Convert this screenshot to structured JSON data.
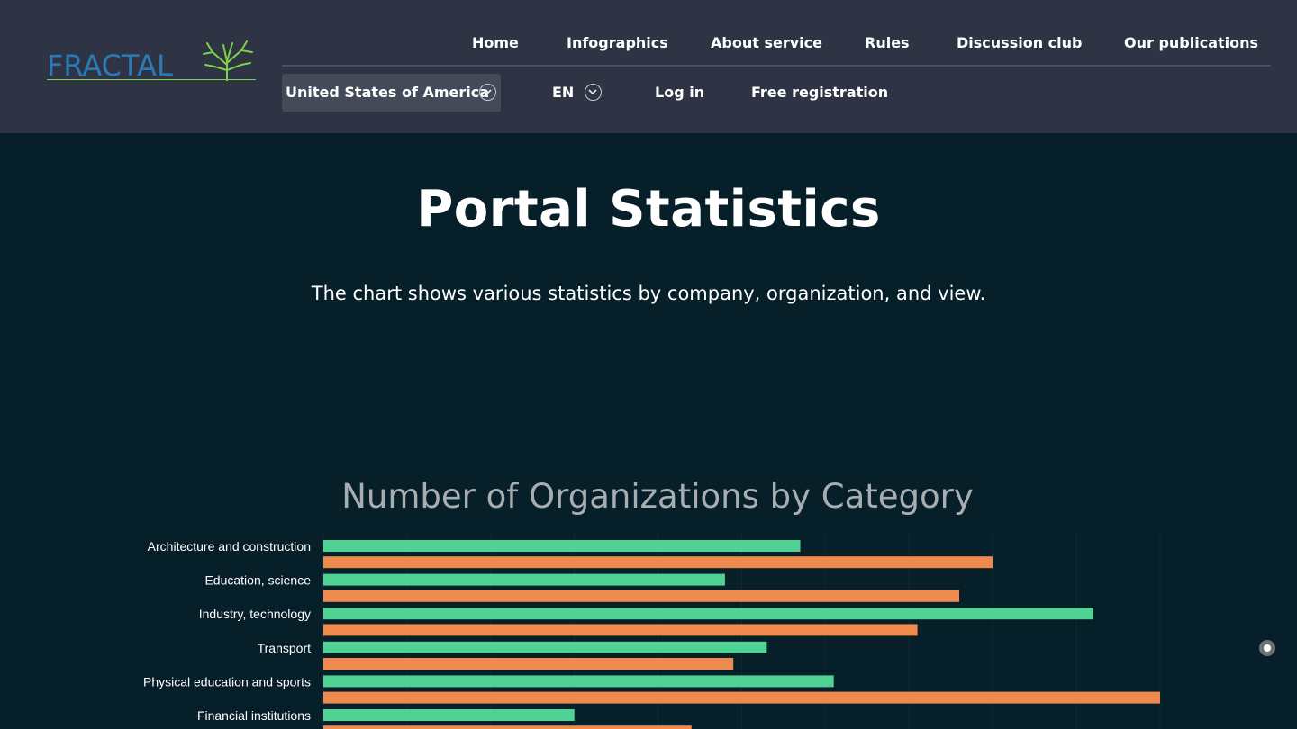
{
  "header": {
    "logo_text": "FRACTAL",
    "nav": [
      {
        "label": "Home"
      },
      {
        "label": "Infographics"
      },
      {
        "label": "About service"
      },
      {
        "label": "Rules"
      },
      {
        "label": "Discussion club"
      },
      {
        "label": "Our publications"
      }
    ],
    "country_select": {
      "value": "United States of America"
    },
    "language_select": {
      "value": "EN"
    },
    "login_label": "Log in",
    "register_label": "Free registration"
  },
  "main": {
    "title": "Portal Statistics",
    "subtitle": "The chart shows various statistics by company, organization, and view."
  },
  "colors": {
    "series_green": "#4fd293",
    "series_orange": "#ef8a4f",
    "header_bg": "#2e3443",
    "page_bg": "#061f29"
  },
  "chart_data": {
    "type": "bar",
    "orientation": "horizontal",
    "title": "Number of Organizations by Category",
    "categories": [
      "Architecture and construction",
      "Education, science",
      "Industry, technology",
      "Transport",
      "Physical education and sports",
      "Financial institutions"
    ],
    "series": [
      {
        "values": [
          57,
          48,
          92,
          53,
          61,
          30
        ]
      },
      {
        "values": [
          80,
          76,
          71,
          49,
          100,
          44
        ]
      }
    ],
    "xlim": [
      0,
      100
    ],
    "grid": true
  }
}
